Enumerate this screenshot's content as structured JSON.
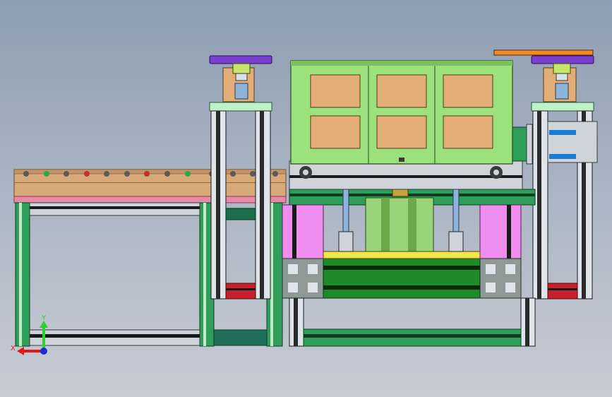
{
  "viewport": {
    "background_top": "#8e9db3",
    "background_bottom": "#c7ccd4"
  },
  "model": {
    "colors": {
      "frame_green": "#2e9e5a",
      "frame_light": "#bfe8c4",
      "conveyor_wood": "#d7a878",
      "conveyor_pink": "#e98aa5",
      "rail_gray": "#cfd3da",
      "tower_plate": "#bff2c8",
      "cabinet_green": "#9be27c",
      "cabinet_panel": "#e3ad78",
      "cylinder_green": "#c7e56a",
      "rod_blue": "#8fb2d8",
      "purple_plate": "#7a3ed0",
      "orange_bar": "#f08a2a",
      "magenta_block": "#f08ef0",
      "dark_green_block": "#1f8a2a",
      "yellow_plate": "#f2e64a",
      "red_block": "#c8202a",
      "blue_slot": "#1a7ad8",
      "profile_gray": "#8f9a96"
    },
    "components": [
      "roller-conveyor",
      "left-press-tower",
      "right-press-tower",
      "cabinet-head",
      "press-ram-assembly",
      "base-frame"
    ]
  },
  "triad": {
    "y_label": "Y",
    "x_label": "X",
    "icon": "coordinate-axes-icon",
    "x_color": "#e01a1a",
    "y_color": "#2bd42b",
    "origin_color": "#1a2ae0"
  }
}
